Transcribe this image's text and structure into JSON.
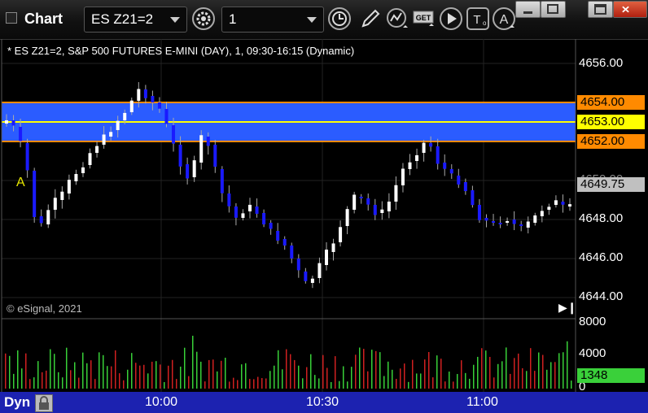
{
  "window": {
    "title": "Chart",
    "symbol": "ES Z21=2",
    "interval": "1"
  },
  "toolbar": {
    "icons": [
      "settings-icon",
      "clock-icon",
      "pencil-icon",
      "studies-icon",
      "get-icon",
      "play-icon",
      "text-icon",
      "alert-icon"
    ],
    "get_label": "GET"
  },
  "chart": {
    "study_info": "* ES Z21=2, S&P 500 FUTURES E-MINI (DAY), 1, 09:30-16:15 (Dynamic)",
    "copyright": "© eSignal, 2021",
    "marker": "A",
    "price_axis": [
      "4656.00",
      "4650.00",
      "4648.00",
      "4646.00",
      "4644.00"
    ],
    "price_tags": [
      {
        "label": "4654.00",
        "color": "#ff8a00",
        "text_color": "#000"
      },
      {
        "label": "4653.00",
        "color": "#ffff00",
        "text_color": "#000"
      },
      {
        "label": "4652.00",
        "color": "#ff8a00",
        "text_color": "#000"
      },
      {
        "label": "4649.75",
        "color": "#c0c0c0",
        "text_color": "#000"
      }
    ],
    "band_color": "#2b5cff",
    "up_color": "#ffffff",
    "down_color": "#1a1aff"
  },
  "volume": {
    "axis": [
      "8000",
      "4000",
      "0"
    ],
    "last": "1348",
    "up_color": "#38d038",
    "down_color": "#d02020"
  },
  "footer": {
    "mode": "Dyn",
    "times": [
      "10:00",
      "10:30",
      "11:00"
    ]
  }
}
